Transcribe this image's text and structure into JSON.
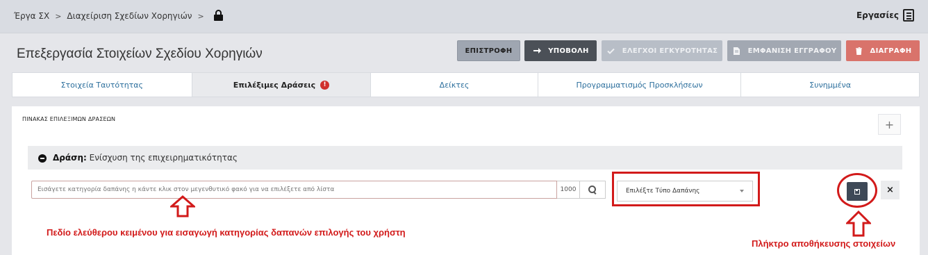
{
  "breadcrumb": {
    "items": [
      "Έργα ΣΧ",
      "Διαχείριση Σχεδίων Χορηγιών"
    ],
    "separator": ">"
  },
  "header": {
    "tasks_label": "Εργασίες",
    "tasks_icon": "document-list-icon",
    "lock_icon": "lock-icon"
  },
  "page": {
    "title": "Επεξεργασία Στοιχείων Σχεδίου Χορηγιών"
  },
  "toolbar": {
    "back_label": "ΕΠΙΣΤΡΟΦΗ",
    "submit_label": "ΥΠΟΒΟΛΗ",
    "validate_label": "ΕΛΕΓΧΟΙ ΕΓΚΥΡΟΤΗΤΑΣ",
    "show_doc_label": "ΕΜΦΑΝΙΣΗ ΕΓΓΡΑΦΟΥ",
    "delete_label": "ΔΙΑΓΡΑΦΗ"
  },
  "tabs": [
    {
      "label": "Στοιχεία Ταυτότητας",
      "active": false
    },
    {
      "label": "Επιλέξιμες Δράσεις",
      "active": true,
      "warning": true
    },
    {
      "label": "Δείκτες",
      "active": false
    },
    {
      "label": "Προγραμματισμός Προσκλήσεων",
      "active": false
    },
    {
      "label": "Συνημμένα",
      "active": false
    }
  ],
  "panel": {
    "title": "ΠΙΝΑΚΑΣ ΕΠΙΛΕΞΙΜΩΝ ΔΡΑΣΕΩΝ",
    "add_symbol": "+"
  },
  "action": {
    "prefix": "Δράση:",
    "name": "Ενίσχυση της επιχειρηματικότητας"
  },
  "expense_input": {
    "placeholder": "Εισάγετε κατηγορία δαπάνης η κάντε κλικ στον μεγενθυτικό φακό για να επιλέξετε από λίστα",
    "counter": "1000"
  },
  "expense_type_select": {
    "selected": "Επιλέξτε Τύπο Δαπάνης"
  },
  "annotations": {
    "input_note": "Πεδίο ελεύθερου κειμένου για εισαγωγή κατηγορίας δαπανών επιλογής του χρήστη",
    "save_note": "Πλήκτρο αποθήκευσης στοιχείων",
    "highlight_color": "#d21a1a"
  },
  "colors": {
    "submit_bg": "#4b5057",
    "delete_bg": "#d9736b",
    "tab_link": "#2b6e9c"
  }
}
